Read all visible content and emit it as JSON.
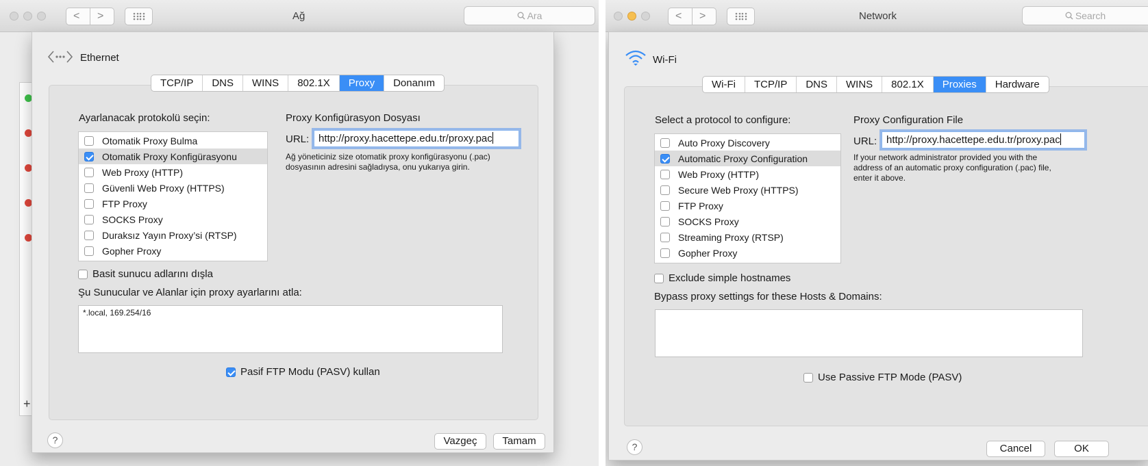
{
  "tr": {
    "window_title": "Ağ",
    "search_placeholder": "Ara",
    "nav_back": "<",
    "nav_forward": ">",
    "interface_name": "Ethernet",
    "tabs": [
      "TCP/IP",
      "DNS",
      "WINS",
      "802.1X",
      "Proxy",
      "Donanım"
    ],
    "active_tab": "Proxy",
    "protocol_label": "Ayarlanacak protokolü seçin:",
    "protocols": [
      {
        "label": "Otomatik Proxy Bulma",
        "checked": false
      },
      {
        "label": "Otomatik Proxy Konfigürasyonu",
        "checked": true,
        "selected": true
      },
      {
        "label": "Web Proxy (HTTP)",
        "checked": false
      },
      {
        "label": "Güvenli Web Proxy (HTTPS)",
        "checked": false
      },
      {
        "label": "FTP Proxy",
        "checked": false
      },
      {
        "label": "SOCKS Proxy",
        "checked": false
      },
      {
        "label": "Duraksız Yayın Proxy’si (RTSP)",
        "checked": false
      },
      {
        "label": "Gopher Proxy",
        "checked": false
      }
    ],
    "config_title": "Proxy Konfigürasyon Dosyası",
    "url_label": "URL:",
    "url_value": "http://proxy.hacettepe.edu.tr/proxy.pac",
    "help_line1": "Ağ yöneticiniz size otomatik proxy konfigürasyonu (.pac)",
    "help_line2": "dosyasının adresini sağladıysa, onu yukarıya girin.",
    "exclude_label": "Basit sunucu adlarını dışla",
    "bypass_label": "Şu Sunucular ve Alanlar için proxy ayarlarını atla:",
    "bypass_value": "*.local, 169.254/16",
    "pasv_label": "Pasif FTP Modu (PASV) kullan",
    "pasv_checked": true,
    "help_button": "?",
    "cancel": "Vazgeç",
    "ok": "Tamam",
    "bg_plus": "+"
  },
  "en": {
    "window_title": "Network",
    "search_placeholder": "Search",
    "nav_back": "<",
    "nav_forward": ">",
    "interface_name": "Wi-Fi",
    "tabs": [
      "Wi-Fi",
      "TCP/IP",
      "DNS",
      "WINS",
      "802.1X",
      "Proxies",
      "Hardware"
    ],
    "active_tab": "Proxies",
    "protocol_label": "Select a protocol to configure:",
    "protocols": [
      {
        "label": "Auto Proxy Discovery",
        "checked": false
      },
      {
        "label": "Automatic Proxy Configuration",
        "checked": true,
        "selected": true
      },
      {
        "label": "Web Proxy (HTTP)",
        "checked": false
      },
      {
        "label": "Secure Web Proxy (HTTPS)",
        "checked": false
      },
      {
        "label": "FTP Proxy",
        "checked": false
      },
      {
        "label": "SOCKS Proxy",
        "checked": false
      },
      {
        "label": "Streaming Proxy (RTSP)",
        "checked": false
      },
      {
        "label": "Gopher Proxy",
        "checked": false
      }
    ],
    "config_title": "Proxy Configuration File",
    "url_label": "URL:",
    "url_value": "http://proxy.hacettepe.edu.tr/proxy.pac",
    "help_line1": "If your network administrator provided you with the",
    "help_line2": "address of an automatic proxy configuration (.pac) file,",
    "help_line3": "enter it above.",
    "exclude_label": "Exclude simple hostnames",
    "bypass_label": "Bypass proxy settings for these Hosts & Domains:",
    "bypass_value": "",
    "pasv_label": "Use Passive FTP Mode (PASV)",
    "pasv_checked": false,
    "help_button": "?",
    "cancel": "Cancel",
    "ok": "OK"
  },
  "colors": {
    "accent": "#3a8ef6",
    "status_green": "#3fc24b",
    "status_red": "#e0473c",
    "traffic_yellow": "#f6bf50"
  },
  "icons": {
    "ethernet": "ethernet-arrows-icon",
    "wifi": "wifi-icon",
    "search": "search-icon",
    "apps_grid": "grid-icon"
  }
}
